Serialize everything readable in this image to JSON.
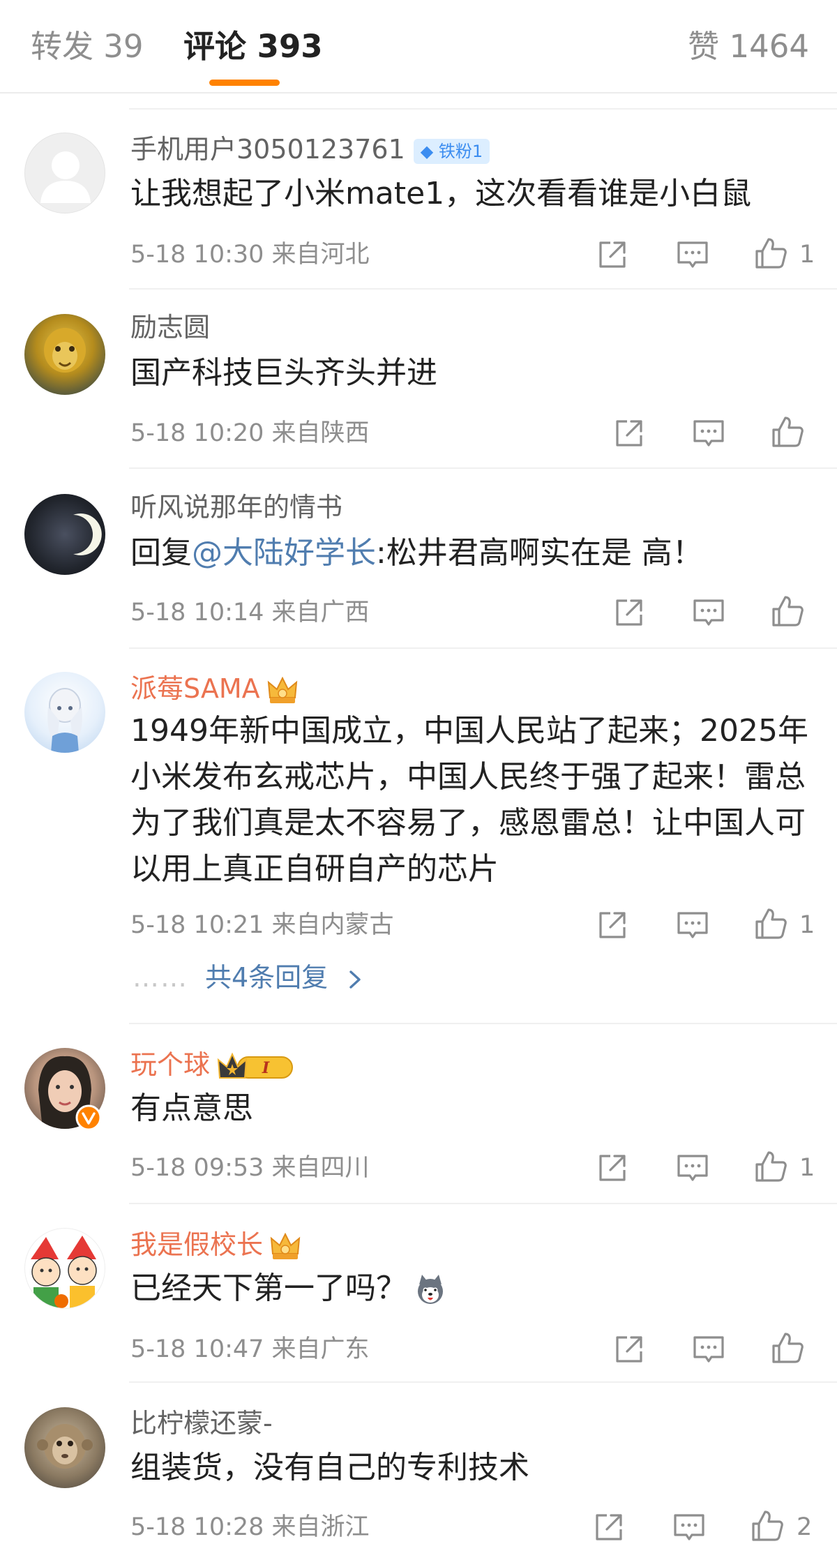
{
  "tabs": {
    "repost": "转发 39",
    "comments": "评论 393",
    "likes": "赞 1464"
  },
  "colors": {
    "accent": "#ff8200",
    "vip_name": "#eb7350",
    "link": "#507daf"
  },
  "comments": [
    {
      "username": "手机用户3050123761",
      "badge": "铁粉1",
      "text": "让我想起了小米mate1，这次看看谁是小白鼠",
      "meta": "5-18 10:30  来自河北",
      "likes": "1",
      "avatar": "default-avatar"
    },
    {
      "username": "励志圆",
      "text": "国产科技巨头齐头并进",
      "meta": "5-18 10:20  来自陕西",
      "likes": "",
      "avatar": "golden-lion-avatar"
    },
    {
      "username": "听风说那年的情书",
      "text_prefix": "回复",
      "mention": "@大陆好学长",
      "text_suffix": ":松井君高啊实在是 高！",
      "meta": "5-18 10:14  来自广西",
      "likes": "",
      "avatar": "crescent-moon-avatar"
    },
    {
      "username": "派莓SAMA",
      "text_lines": [
        "1949年新中国成立，中国人民站了起来；2025年",
        "小米发布玄戒芯片，中国人民终于强了起来！雷总",
        "为了我们真是太不容易了，感恩雷总！让中国人可",
        "以用上真正自研自产的芯片"
      ],
      "meta": "5-18 10:21  来自内蒙古",
      "likes": "1",
      "replies_link": "共4条回复",
      "replies_dots": "……",
      "avatar": "anime-girl-avatar"
    },
    {
      "username": "玩个球",
      "text": "有点意思",
      "meta": "5-18 09:53  来自四川",
      "likes": "1",
      "avatar": "person-avatar"
    },
    {
      "username": "我是假校长",
      "text": "已经天下第一了吗？",
      "meta": "5-18 10:47  来自广东",
      "likes": "",
      "avatar": "cartoon-kids-avatar"
    },
    {
      "username": "比柠檬还蒙-",
      "text": "组装货，没有自己的专利技术",
      "meta": "5-18 10:28  来自浙江",
      "likes": "2",
      "avatar": "monkey-avatar"
    }
  ]
}
